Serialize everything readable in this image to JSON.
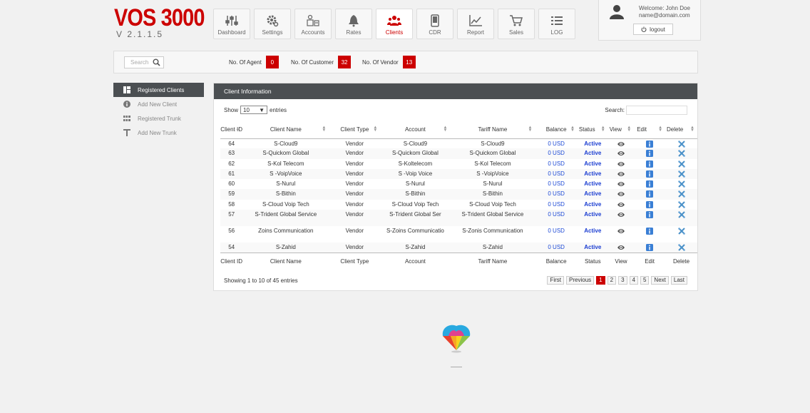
{
  "brand": {
    "title": "VOS 3000",
    "version": "V 2.1.1.5"
  },
  "nav": [
    {
      "label": "Dashboard",
      "icon": "sliders-icon"
    },
    {
      "label": "Settings",
      "icon": "gear-icon"
    },
    {
      "label": "Accounts",
      "icon": "accounts-icon"
    },
    {
      "label": "Rates",
      "icon": "bell-icon"
    },
    {
      "label": "Clients",
      "icon": "users-icon",
      "active": true
    },
    {
      "label": "CDR",
      "icon": "phone-icon"
    },
    {
      "label": "Report",
      "icon": "chart-icon"
    },
    {
      "label": "Sales",
      "icon": "cart-icon"
    },
    {
      "label": "LOG",
      "icon": "list-icon"
    }
  ],
  "user": {
    "welcome": "Welcome: John Doe",
    "email": "name@domain.com",
    "logout": "logout"
  },
  "topbar": {
    "search_placeholder": "Search",
    "agents_label": "No. Of Agent",
    "agents": "0",
    "customers_label": "No. Of Customer",
    "customers": "32",
    "vendors_label": "No. Of Vendor",
    "vendors": "13"
  },
  "sidebar": [
    {
      "label": "Registered Clients",
      "icon": "dashboard-icon"
    },
    {
      "label": "Add New Client",
      "icon": "info-icon"
    },
    {
      "label": "Registered Trunk",
      "icon": "grid-icon"
    },
    {
      "label": "Add New Trunk",
      "icon": "text-icon"
    }
  ],
  "panel": {
    "title": "Client Information",
    "show_label": "Show",
    "show_value": "10",
    "entries_label": "entries",
    "search_label": "Search:",
    "info": "Showing 1 to 10 of 45 entries"
  },
  "table": {
    "headers": [
      "Client ID",
      "Client Name",
      "Client Type",
      "Account",
      "Tariff Name",
      "Balance",
      "Status",
      "View",
      "Edit",
      "Delete"
    ],
    "rows": [
      {
        "id": "64",
        "name": "S-Cloud9",
        "type": "Vendor",
        "account": "S-Cloud9",
        "tariff": "S-Cloud9",
        "balance": "0 USD",
        "status": "Active"
      },
      {
        "id": "63",
        "name": "S-Quickom Global",
        "type": "Vendor",
        "account": "S-Quickom Global",
        "tariff": "S-Quickom Global",
        "balance": "0 USD",
        "status": "Active"
      },
      {
        "id": "62",
        "name": "S-Kol Telecom",
        "type": "Vendor",
        "account": "S-Koltelecom",
        "tariff": "S-Kol Telecom",
        "balance": "0 USD",
        "status": "Active"
      },
      {
        "id": "61",
        "name": "S -VoipVoice",
        "type": "Vendor",
        "account": "S -Voip Voice",
        "tariff": "S -VoipVoice",
        "balance": "0 USD",
        "status": "Active"
      },
      {
        "id": "60",
        "name": "S-Nurul",
        "type": "Vendor",
        "account": "S-Nurul",
        "tariff": "S-Nurul",
        "balance": "0 USD",
        "status": "Active"
      },
      {
        "id": "59",
        "name": "S-Bithin",
        "type": "Vendor",
        "account": "S-Bithin",
        "tariff": "S-Bithin",
        "balance": "0 USD",
        "status": "Active"
      },
      {
        "id": "58",
        "name": "S-Cloud Voip Tech",
        "type": "Vendor",
        "account": "S-Cloud Voip Tech",
        "tariff": "S-Cloud Voip Tech",
        "balance": "0 USD",
        "status": "Active"
      },
      {
        "id": "57",
        "name": "S-Trident Global Service",
        "type": "Vendor",
        "account": "S-Trident Global Ser",
        "tariff": "S-Trident Global Service",
        "balance": "0 USD",
        "status": "Active"
      },
      {
        "id": "56",
        "name": "Zoins Communication",
        "type": "Vendor",
        "account": "S-Zoins Communicatio",
        "tariff": "S-Zonis Communication",
        "balance": "0 USD",
        "status": "Active"
      },
      {
        "id": "54",
        "name": "S-Zahid",
        "type": "Vendor",
        "account": "S-Zahid",
        "tariff": "S-Zahid",
        "balance": "0 USD",
        "status": "Active"
      }
    ]
  },
  "pagination": {
    "first": "First",
    "previous": "Previous",
    "pages": [
      "1",
      "2",
      "3",
      "4",
      "5"
    ],
    "next": "Next",
    "last": "Last"
  },
  "colors": {
    "accent": "#cc0000",
    "dark_header": "#4b4f52",
    "link": "#1f4bd6"
  }
}
